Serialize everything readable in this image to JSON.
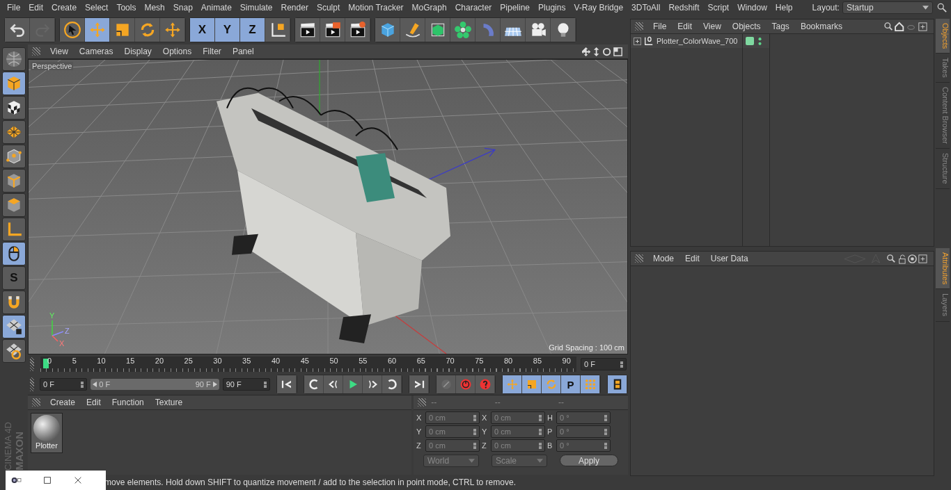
{
  "menu_bar": {
    "items": [
      "File",
      "Edit",
      "Create",
      "Select",
      "Tools",
      "Mesh",
      "Snap",
      "Animate",
      "Simulate",
      "Render",
      "Sculpt",
      "Motion Tracker",
      "MoGraph",
      "Character",
      "Pipeline",
      "Plugins",
      "V-Ray Bridge",
      "3DToAll",
      "Redshift",
      "Script",
      "Window",
      "Help"
    ],
    "layout_label": "Layout:",
    "layout_value": "Startup"
  },
  "toolbar": {
    "groups": [
      [
        {
          "kind": "undo",
          "selected": false
        },
        {
          "kind": "redo",
          "selected": false
        }
      ],
      [
        {
          "kind": "cursor",
          "selected": false
        },
        {
          "kind": "move",
          "selected": true
        },
        {
          "kind": "scale",
          "selected": false
        },
        {
          "kind": "rotate",
          "selected": false
        },
        {
          "kind": "move",
          "selected": false
        }
      ],
      [
        {
          "kind": "letter",
          "label": "X",
          "selected": true
        },
        {
          "kind": "letter",
          "label": "Y",
          "selected": true
        },
        {
          "kind": "letter",
          "label": "Z",
          "selected": true
        },
        {
          "kind": "coord",
          "selected": false
        }
      ],
      [
        {
          "kind": "clapper",
          "selected": false
        },
        {
          "kind": "clapper-red",
          "selected": false
        },
        {
          "kind": "clapper-gear",
          "selected": false
        }
      ],
      [
        {
          "kind": "cube",
          "selected": false
        },
        {
          "kind": "pen",
          "selected": false
        },
        {
          "kind": "green-cube",
          "selected": false
        },
        {
          "kind": "flower",
          "selected": false
        },
        {
          "kind": "deformer",
          "selected": false
        },
        {
          "kind": "floor",
          "selected": false
        },
        {
          "kind": "camera",
          "selected": false
        },
        {
          "kind": "bulb",
          "selected": false
        }
      ]
    ]
  },
  "left_tools": [
    {
      "kind": "sphere",
      "selected": false
    },
    {
      "kind": "model-cube",
      "selected": true
    },
    {
      "kind": "checker-cube",
      "selected": false
    },
    {
      "kind": "grid-plane",
      "selected": false
    },
    {
      "kind": "points",
      "selected": false
    },
    {
      "kind": "edges",
      "selected": false
    },
    {
      "kind": "polygons",
      "selected": false
    },
    {
      "kind": "axis-l",
      "selected": false
    },
    {
      "kind": "mouse",
      "selected": true
    },
    {
      "kind": "letter",
      "label": "S",
      "selected": false
    },
    {
      "kind": "magnet",
      "selected": false
    },
    {
      "kind": "grid-lock",
      "selected": true
    },
    {
      "kind": "grid-rotate",
      "selected": false
    }
  ],
  "brand": [
    "MAXON",
    "CINEMA 4D"
  ],
  "viewport": {
    "menu": [
      "View",
      "Cameras",
      "Display",
      "Options",
      "Filter",
      "Panel"
    ],
    "camera_label": "Perspective",
    "grid_spacing": "Grid Spacing : 100 cm",
    "axis_labels": [
      "Y",
      "Z",
      "X"
    ]
  },
  "timeline": {
    "ticks": [
      "0",
      "5",
      "10",
      "15",
      "20",
      "25",
      "30",
      "35",
      "40",
      "45",
      "50",
      "55",
      "60",
      "65",
      "70",
      "75",
      "80",
      "85",
      "90"
    ],
    "level": 0,
    "current_frame": "0 F"
  },
  "playback": {
    "start_field": "0 F",
    "range": {
      "start": "0 F",
      "end": "90 F",
      "level": 1
    },
    "end_field": "90 F",
    "buttons": [
      [
        {
          "kind": "first",
          "selected": false
        }
      ],
      [
        {
          "kind": "prev-key",
          "selected": false
        },
        {
          "kind": "prev-frame",
          "selected": false
        },
        {
          "kind": "play",
          "selected": false
        },
        {
          "kind": "next-frame",
          "selected": false
        },
        {
          "kind": "next-key",
          "selected": false
        }
      ],
      [
        {
          "kind": "last",
          "selected": false
        }
      ],
      [
        {
          "kind": "record-off",
          "selected": false
        },
        {
          "kind": "record",
          "selected": false
        },
        {
          "kind": "question",
          "selected": false
        }
      ],
      [
        {
          "kind": "move",
          "selected": true
        },
        {
          "kind": "scale",
          "selected": true
        },
        {
          "kind": "rotate",
          "selected": true
        },
        {
          "kind": "letter",
          "label": "P",
          "selected": true
        },
        {
          "kind": "dots",
          "selected": true
        }
      ],
      [
        {
          "kind": "film",
          "selected": true
        }
      ]
    ]
  },
  "material_panel": {
    "menu": [
      "Create",
      "Edit",
      "Function",
      "Texture"
    ],
    "materials": [
      {
        "name": "Plotter"
      }
    ]
  },
  "coordinates": {
    "headers": [
      "--",
      "--",
      "--"
    ],
    "rows": [
      {
        "pos_axis": "X",
        "pos": "0 cm",
        "size_axis": "X",
        "size": "0 cm",
        "rot_axis": "H",
        "rot": "0 °"
      },
      {
        "pos_axis": "Y",
        "pos": "0 cm",
        "size_axis": "Y",
        "size": "0 cm",
        "rot_axis": "P",
        "rot": "0 °"
      },
      {
        "pos_axis": "Z",
        "pos": "0 cm",
        "size_axis": "Z",
        "size": "0 cm",
        "rot_axis": "B",
        "rot": "0 °"
      }
    ],
    "mode": "World",
    "scale_mode": "Scale",
    "apply": "Apply"
  },
  "status_bar": {
    "text": "move elements. Hold down SHIFT to quantize movement / add to the selection in point mode, CTRL to remove."
  },
  "objects_panel": {
    "menu": [
      "File",
      "Edit",
      "View",
      "Objects",
      "Tags",
      "Bookmarks"
    ],
    "objects": [
      {
        "name": "Plotter_ColorWave_700",
        "expanded": false
      }
    ]
  },
  "attributes_panel": {
    "menu": [
      "Mode",
      "Edit",
      "User Data"
    ]
  },
  "side_tabs_top": [
    {
      "label": "Objects",
      "selected": true
    },
    {
      "label": "Takes",
      "selected": false
    },
    {
      "label": "Content Browser",
      "selected": false
    },
    {
      "label": "Structure",
      "selected": false
    }
  ],
  "side_tabs_bottom": [
    {
      "label": "Attributes",
      "selected": true
    },
    {
      "label": "Layers",
      "selected": false
    }
  ]
}
